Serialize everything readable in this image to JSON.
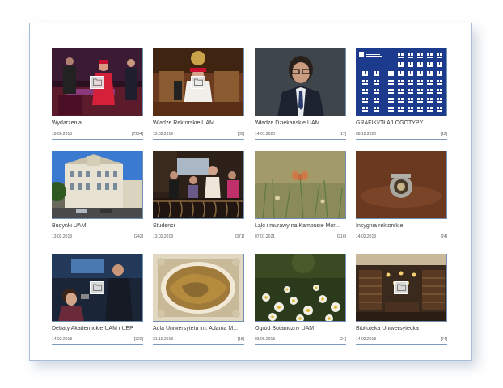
{
  "gallery": {
    "albums": [
      {
        "title": "Wydarzenia",
        "date": "18.06.2018",
        "count": "[7294]",
        "thumb": "concert",
        "has_folder_badge": true
      },
      {
        "title": "Władze Rektorskie UAM",
        "date": "13.02.2019",
        "count": "[39]",
        "thumb": "rector",
        "has_folder_badge": true
      },
      {
        "title": "Władze Dziekańskie UAM",
        "date": "14.01.2020",
        "count": "[17]",
        "thumb": "portrait",
        "has_folder_badge": false
      },
      {
        "title": "GRAFIKI/TŁA/LOGOTYPY",
        "date": "08.12.2020",
        "count": "[12]",
        "thumb": "logos",
        "has_folder_badge": false
      },
      {
        "title": "Budynki UAM",
        "date": "13.02.2018",
        "count": "[242]",
        "thumb": "building",
        "has_folder_badge": false
      },
      {
        "title": "Studenci",
        "date": "13.02.2018",
        "count": "[371]",
        "thumb": "students",
        "has_folder_badge": false
      },
      {
        "title": "Łąki i murawy na Kampusie Mor...",
        "date": "07.07.2021",
        "count": "[216]",
        "thumb": "meadow",
        "has_folder_badge": false
      },
      {
        "title": "Insygnia rektorskie",
        "date": "14.02.2018",
        "count": "[24]",
        "thumb": "insignia",
        "has_folder_badge": false
      },
      {
        "title": "Debaty Akademickie UAM i UEP",
        "date": "14.02.2018",
        "count": "[322]",
        "thumb": "debate",
        "has_folder_badge": true
      },
      {
        "title": "Aula Uniwersytetu im. Adama M...",
        "date": "31.10.2018",
        "count": "[15]",
        "thumb": "ceiling",
        "has_folder_badge": false
      },
      {
        "title": "Ogród Botaniczny UAM",
        "date": "03.06.2018",
        "count": "[24]",
        "thumb": "garden",
        "has_folder_badge": false
      },
      {
        "title": "Biblioteka Uniwersytecka",
        "date": "14.02.2018",
        "count": "[74]",
        "thumb": "library",
        "has_folder_badge": true
      }
    ]
  },
  "colors": {
    "frame_border": "#a9bdd6",
    "underline": "#7d9bbd",
    "logo_blue": "#1d3b8c"
  }
}
